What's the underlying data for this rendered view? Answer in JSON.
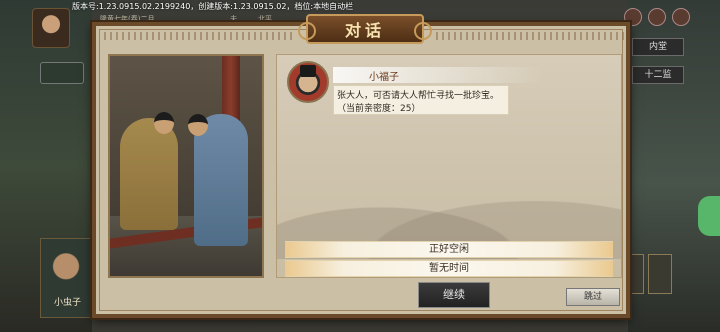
{
  "status_bar": {
    "version_text": "版本号:1.23.0915.02.2199240，创建版本:1.23.0915.02，档位:本地自动栏"
  },
  "hud": {
    "date": "隆黄七年(春)二月",
    "season": "夫",
    "city": "北平",
    "right_tab_1": "内堂",
    "right_tab_2": "十二监",
    "side_tab": "",
    "portrait_name": "小虫子"
  },
  "dialog": {
    "title": "对话",
    "speaker_name": "小福子",
    "speech_line1": "张大人，可否请大人帮忙寻找一批珍宝。",
    "speech_line2": "（当前亲密度：25）",
    "options": [
      "正好空闲",
      "暂无时间"
    ],
    "continue_label": "继续",
    "skip_label": "跳过"
  },
  "colors": {
    "dialog_bg": "#cbbfa6",
    "dialog_border": "#6b4a2a",
    "title_text": "#f6e2b0",
    "accent_green": "#57b66a"
  }
}
